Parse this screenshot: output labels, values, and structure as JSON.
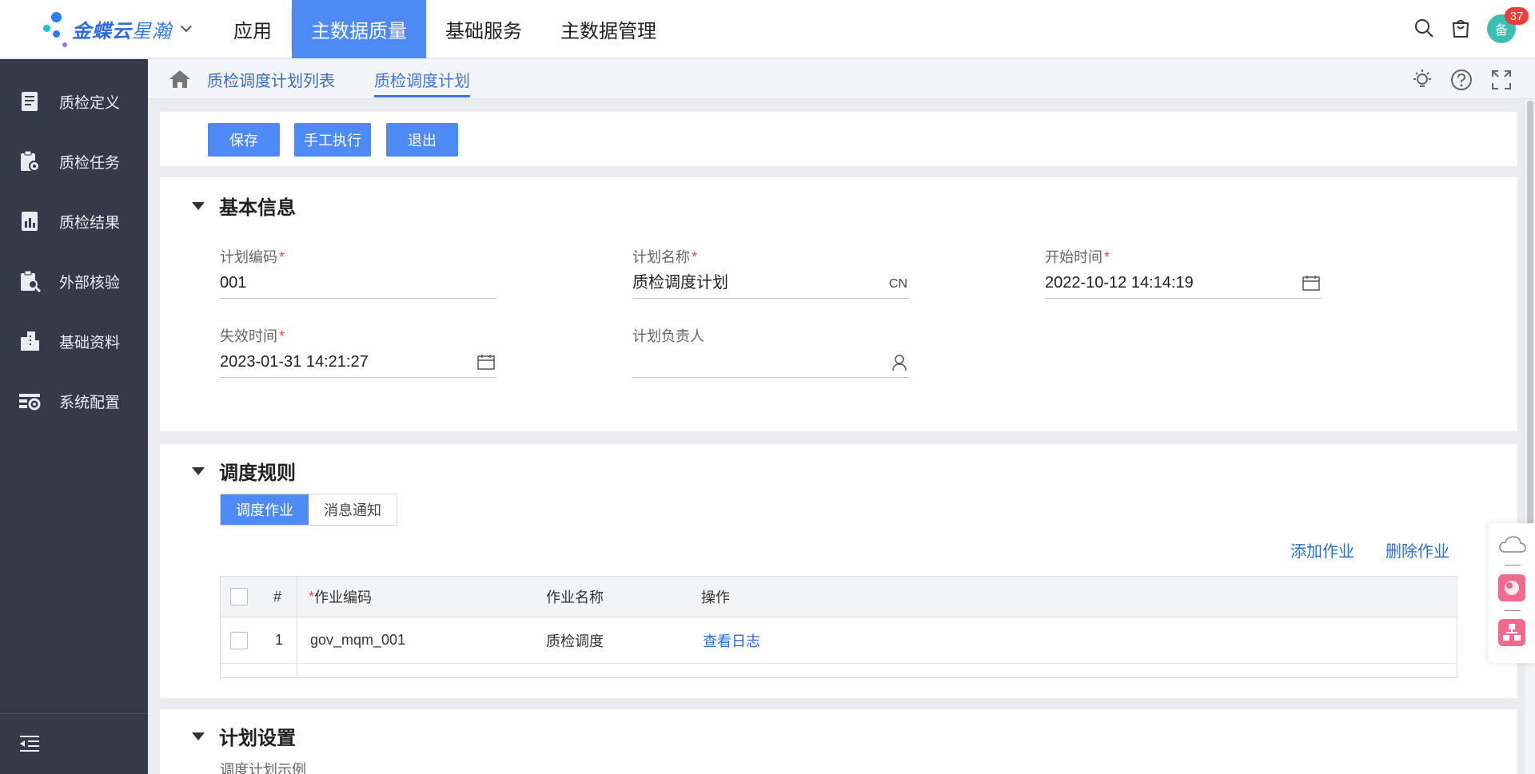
{
  "brand": {
    "name": "金蝶云",
    "product": "星瀚"
  },
  "topnav": {
    "items": [
      "应用",
      "主数据质量",
      "基础服务",
      "主数据管理"
    ],
    "active_index": 1
  },
  "header": {
    "badge_count": "37",
    "avatar_text": "备"
  },
  "sidebar": {
    "items": [
      {
        "label": "质检定义",
        "icon": "book-icon"
      },
      {
        "label": "质检任务",
        "icon": "task-clipboard-icon"
      },
      {
        "label": "质检结果",
        "icon": "report-icon"
      },
      {
        "label": "外部核验",
        "icon": "clipboard-search-icon"
      },
      {
        "label": "基础资料",
        "icon": "building-icon"
      },
      {
        "label": "系统配置",
        "icon": "settings-list-icon"
      }
    ]
  },
  "tabs": [
    {
      "label": "质检调度计划列表"
    },
    {
      "label": "质检调度计划"
    }
  ],
  "toolbar": {
    "save_label": "保存",
    "manual_label": "手工执行",
    "exit_label": "退出"
  },
  "basic_info": {
    "title": "基本信息",
    "plan_code": {
      "label": "计划编码",
      "value": "001"
    },
    "plan_name": {
      "label": "计划名称",
      "value": "质检调度计划",
      "lang": "CN"
    },
    "start_time": {
      "label": "开始时间",
      "value": "2022-10-12 14:14:19"
    },
    "expire_time": {
      "label": "失效时间",
      "value": "2023-01-31 14:21:27"
    },
    "owner": {
      "label": "计划负责人",
      "value": ""
    }
  },
  "schedule": {
    "title": "调度规则",
    "tabs": [
      "调度作业",
      "消息通知"
    ],
    "add_label": "添加作业",
    "delete_label": "删除作业",
    "columns": {
      "index": "#",
      "code": "作业编码",
      "name": "作业名称",
      "action": "操作"
    },
    "rows": [
      {
        "index": "1",
        "code": "gov_mqm_001",
        "name": "质检调度",
        "action": "查看日志"
      }
    ]
  },
  "plan_settings": {
    "title": "计划设置",
    "example_label": "调度计划示例"
  },
  "colors": {
    "primary": "#4e8af5",
    "sidebar": "#343a48",
    "link": "#2a6fd0",
    "required": "#e34d4d"
  }
}
